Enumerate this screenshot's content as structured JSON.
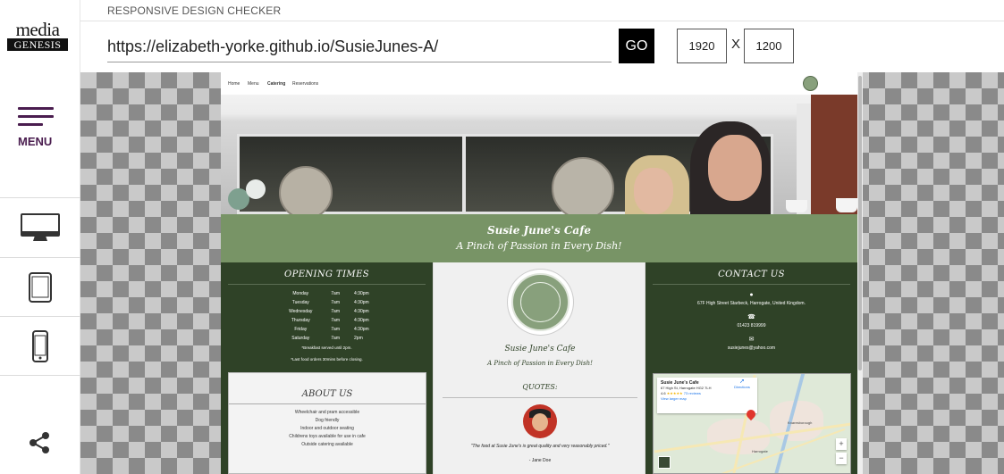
{
  "app": {
    "title": "RESPONSIVE DESIGN CHECKER",
    "logo_line1": "media",
    "logo_line2": "GENESIS",
    "menu_label": "MENU"
  },
  "toolbar": {
    "url": "https://elizabeth-yorke.github.io/SusieJunes-A/",
    "go_label": "GO",
    "width": "1920",
    "height": "1200",
    "separator": "X"
  },
  "devices": [
    {
      "icon": "desktop-icon"
    },
    {
      "icon": "tablet-icon"
    },
    {
      "icon": "mobile-icon"
    }
  ],
  "site": {
    "nav": [
      "Home",
      "Menu",
      "Catering",
      "Reservations"
    ],
    "nav_active": "Catering",
    "banner_title": "Susie June's Cafe",
    "banner_tagline": "A Pinch of Passion in Every Dish!",
    "opening": {
      "heading": "OPENING TIMES",
      "rows": [
        [
          "Monday",
          "7am",
          "4:30pm"
        ],
        [
          "Tuesday",
          "7am",
          "4:30pm"
        ],
        [
          "Wednesday",
          "7am",
          "4:30pm"
        ],
        [
          "Thursday",
          "7am",
          "4:30pm"
        ],
        [
          "Friday",
          "7am",
          "4:30pm"
        ],
        [
          "Saturday",
          "7am",
          "2pm"
        ]
      ],
      "note1": "*Breakfast served until 2pm.",
      "note2": "*Last food orders 30mins before closing."
    },
    "about": {
      "heading": "ABOUT US",
      "lines": [
        "Wheelchair and pram accessible",
        "Dog friendly",
        "Indoor and outdoor seating",
        "Childrens toys available for use in cafe",
        "Outside catering available"
      ]
    },
    "center": {
      "name": "Susie June's Cafe",
      "tagline": "A Pinch of Passion in Every Dish!",
      "quotes_heading": "QUOTES:",
      "quote": "\"The food at Susie June's is great quality and very reasonably priced.\"",
      "quote_by": "- Jane Doe"
    },
    "contact": {
      "heading": "CONTACT US",
      "address": "67F High Street Starbeck, Harrogate, United Kingdom.",
      "phone": "01423 819999",
      "email": "susiejunes@yahoo.com"
    },
    "map": {
      "place": "Susie June's Cafe",
      "address": "67 High St, Harrogate HG2 7LH",
      "rating": "4.6",
      "reviews": "73 reviews",
      "directions": "Directions",
      "larger_map": "View larger map",
      "zoom_in": "+",
      "zoom_out": "−"
    }
  }
}
